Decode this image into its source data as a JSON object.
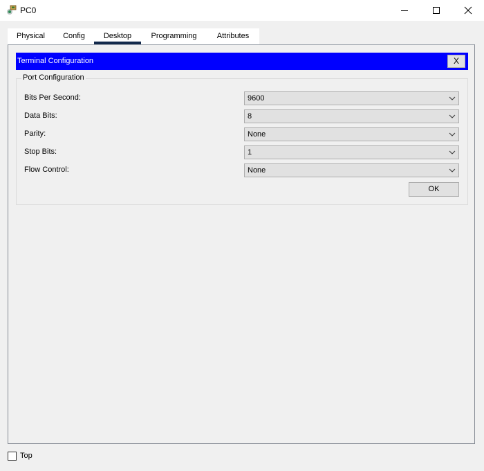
{
  "window": {
    "title": "PC0",
    "icons": {
      "app": "pc-device-icon",
      "minimize": "minimize-icon",
      "maximize": "maximize-icon",
      "close": "close-icon"
    }
  },
  "tabs": [
    {
      "label": "Physical",
      "active": false
    },
    {
      "label": "Config",
      "active": false
    },
    {
      "label": "Desktop",
      "active": true
    },
    {
      "label": "Programming",
      "active": false
    },
    {
      "label": "Attributes",
      "active": false
    }
  ],
  "terminal_config": {
    "title": "Terminal Configuration",
    "close_label": "X",
    "group_title": "Port Configuration",
    "fields": [
      {
        "label": "Bits Per Second:",
        "value": "9600"
      },
      {
        "label": "Data Bits:",
        "value": "8"
      },
      {
        "label": "Parity:",
        "value": "None"
      },
      {
        "label": "Stop Bits:",
        "value": "1"
      },
      {
        "label": "Flow Control:",
        "value": "None"
      }
    ],
    "ok_label": "OK"
  },
  "footer": {
    "top_label": "Top",
    "top_checked": false
  },
  "colors": {
    "header_bg": "#0000ff",
    "active_tab_underline": "#12294b"
  }
}
